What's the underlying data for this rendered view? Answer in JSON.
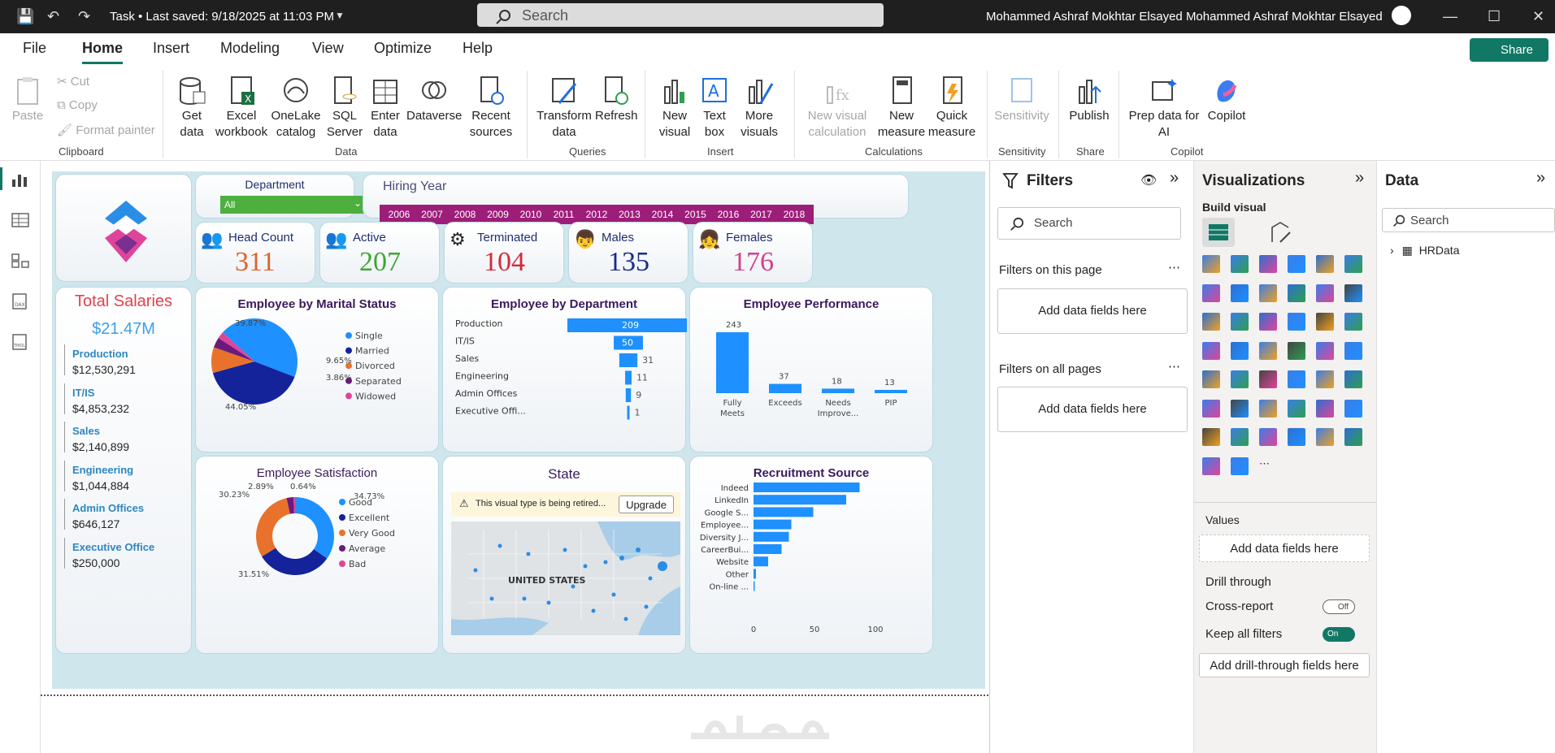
{
  "titlebar": {
    "title": "Task • Last saved: 9/18/2025 at 11:03 PM",
    "search": "Search",
    "user": "Mohammed Ashraf Mokhtar Elsayed Mohammed Ashraf Mokhtar Elsayed"
  },
  "menu": {
    "file": "File",
    "home": "Home",
    "insert": "Insert",
    "modeling": "Modeling",
    "view": "View",
    "optimize": "Optimize",
    "help": "Help",
    "share": "Share"
  },
  "ribbon": {
    "paste": "Paste",
    "cut": "Cut",
    "copy": "Copy",
    "format_painter": "Format painter",
    "get_data": "Get data",
    "excel": "Excel workbook",
    "onelake": "OneLake catalog",
    "sql": "SQL Server",
    "enter": "Enter data",
    "dataverse": "Dataverse",
    "recent": "Recent sources",
    "transform": "Transform data",
    "refresh": "Refresh",
    "new_visual": "New visual",
    "text_box": "Text box",
    "more_visuals": "More visuals",
    "new_calc": "New visual calculation",
    "new_measure": "New measure",
    "quick_measure": "Quick measure",
    "sensitivity": "Sensitivity",
    "publish": "Publish",
    "prep": "Prep data for AI",
    "copilot": "Copilot",
    "groups": {
      "clipboard": "Clipboard",
      "data": "Data",
      "queries": "Queries",
      "insert": "Insert",
      "calculations": "Calculations",
      "sensitivity": "Sensitivity",
      "share": "Share",
      "copilot": "Copilot"
    }
  },
  "report": {
    "department": {
      "title": "Department",
      "value": "All"
    },
    "hiring": {
      "title": "Hiring Year",
      "years": [
        "2006",
        "2007",
        "2008",
        "2009",
        "2010",
        "2011",
        "2012",
        "2013",
        "2014",
        "2015",
        "2016",
        "2017",
        "2018"
      ]
    },
    "kpis": [
      {
        "label": "Head Count",
        "value": "311",
        "color": "#e0622a"
      },
      {
        "label": "Active",
        "value": "207",
        "color": "#3fa535"
      },
      {
        "label": "Terminated",
        "value": "104",
        "color": "#d42a3a"
      },
      {
        "label": "Males",
        "value": "135",
        "color": "#1a2a8a"
      },
      {
        "label": "Females",
        "value": "176",
        "color": "#d43f8d"
      }
    ],
    "salaries": {
      "title": "Total Salaries",
      "total": "$21.47M",
      "items": [
        {
          "dept": "Production",
          "value": "$12,530,291"
        },
        {
          "dept": "IT/IS",
          "value": "$4,853,232"
        },
        {
          "dept": "Sales",
          "value": "$2,140,899"
        },
        {
          "dept": "Engineering",
          "value": "$1,044,884"
        },
        {
          "dept": "Admin Offices",
          "value": "$646,127"
        },
        {
          "dept": "Executive Office",
          "value": "$250,000"
        }
      ]
    },
    "marital": {
      "title": "Employee by Marital Status",
      "labels": [
        "39.87%",
        "9.65%",
        "3.86%",
        "44.05%"
      ],
      "legend": [
        "Single",
        "Married",
        "Divorced",
        "Separated",
        "Widowed"
      ]
    },
    "dept_chart": {
      "title": "Employee by Department"
    },
    "perf": {
      "title": "Employee Performance"
    },
    "satisfaction": {
      "title": "Employee Satisfaction",
      "labels": [
        "2.89%",
        "0.64%",
        "30.23%",
        "34.73%",
        "31.51%"
      ],
      "legend": [
        "Good",
        "Excellent",
        "Very Good",
        "Average",
        "Bad"
      ]
    },
    "state": {
      "title": "State",
      "warning": "This visual type is being retired...",
      "upgrade": "Upgrade",
      "map_label": "UNITED STATES"
    },
    "recruit": {
      "title": "Recruitment Source"
    }
  },
  "filters": {
    "title": "Filters",
    "search": "Search",
    "on_page": "Filters on this page",
    "on_all": "Filters on all pages",
    "add1": "Add data fields here",
    "add2": "Add data fields here"
  },
  "viz": {
    "title": "Visualizations",
    "build": "Build visual",
    "values": "Values",
    "add_values": "Add data fields here",
    "drill": "Drill through",
    "cross": "Cross-report",
    "cross_state": "Off",
    "keep": "Keep all filters",
    "keep_state": "On",
    "add_drill": "Add drill-through fields here"
  },
  "data": {
    "title": "Data",
    "search": "Search",
    "table": "HRData"
  },
  "chart_data": [
    {
      "type": "pie",
      "title": "Employee by Marital Status",
      "categories": [
        "Single",
        "Married",
        "Divorced",
        "Separated",
        "Widowed"
      ],
      "values": [
        44.05,
        39.87,
        9.65,
        3.86,
        2.57
      ],
      "colors": [
        "#1e90ff",
        "#14239a",
        "#e8722c",
        "#6a1b7a",
        "#e0449a"
      ]
    },
    {
      "type": "bar",
      "title": "Employee by Department",
      "categories": [
        "Production",
        "IT/IS",
        "Sales",
        "Engineering",
        "Admin Offices",
        "Executive Offi..."
      ],
      "values": [
        209,
        50,
        31,
        11,
        9,
        1
      ]
    },
    {
      "type": "bar",
      "title": "Employee Performance",
      "categories": [
        "Fully Meets",
        "Exceeds",
        "Needs Improve...",
        "PIP"
      ],
      "values": [
        243,
        37,
        18,
        13
      ]
    },
    {
      "type": "pie",
      "title": "Employee Satisfaction",
      "categories": [
        "Good",
        "Excellent",
        "Very Good",
        "Average",
        "Bad"
      ],
      "values": [
        34.73,
        31.51,
        30.23,
        2.89,
        0.64
      ],
      "colors": [
        "#1e90ff",
        "#14239a",
        "#e8722c",
        "#6a1b7a",
        "#e0449a"
      ]
    },
    {
      "type": "bar",
      "title": "Recruitment Source",
      "categories": [
        "Indeed",
        "LinkedIn",
        "Google S...",
        "Employee...",
        "Diversity J...",
        "CareerBui...",
        "Website",
        "Other",
        "On-line ..."
      ],
      "values": [
        87,
        76,
        49,
        31,
        29,
        23,
        12,
        2,
        1
      ],
      "xticks": [
        "0",
        "50",
        "100"
      ],
      "xlim": [
        0,
        100
      ]
    }
  ]
}
